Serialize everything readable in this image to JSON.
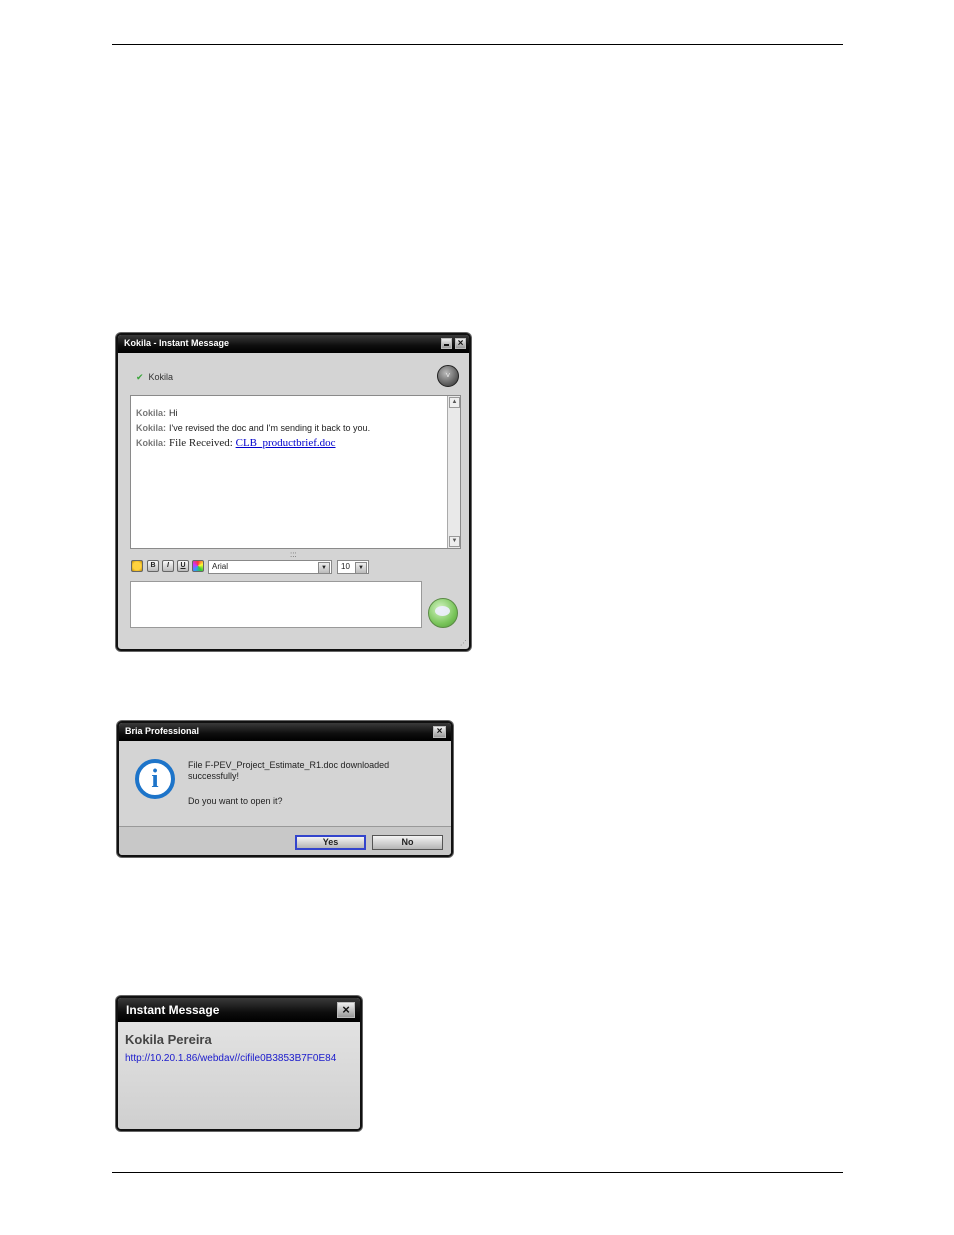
{
  "im_window": {
    "title": "Kokila - Instant Message",
    "contact_name": "Kokila",
    "messages": [
      {
        "sender": "Kokila:",
        "text": "Hi"
      },
      {
        "sender": "Kokila:",
        "text": "I've revised the doc and I'm sending it back to you."
      },
      {
        "sender": "Kokila:",
        "text": "File Received: ",
        "link": "CLB_productbrief.doc"
      }
    ],
    "toolbar": {
      "bold": "B",
      "italic": "I",
      "underline": "U",
      "font": "Arial",
      "size": "10"
    },
    "message_input": ""
  },
  "bria_dialog": {
    "title": "Bria Professional",
    "message_line1": "File F-PEV_Project_Estimate_R1.doc downloaded",
    "message_line2": "successfully!",
    "question": "Do you want to open it?",
    "yes_label": "Yes",
    "no_label": "No"
  },
  "toast": {
    "title": "Instant Message",
    "sender": "Kokila Pereira",
    "url": "http://10.20.1.86/webdav//cifile0B3853B7F0E84"
  },
  "icons": {
    "presence": "check-icon",
    "options": "chevron-down-icon",
    "send": "speech-bubble-icon",
    "info": "info-icon",
    "close": "close-icon",
    "minimize": "minimize-icon"
  }
}
